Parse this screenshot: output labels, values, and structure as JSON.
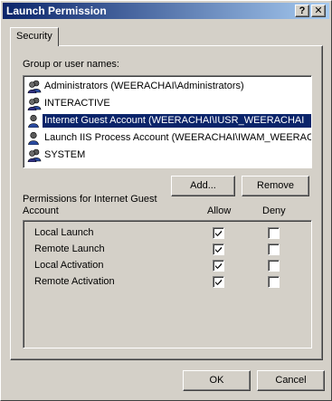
{
  "window": {
    "title": "Launch Permission",
    "help_button": "?",
    "close_button": "✕"
  },
  "tabs": [
    {
      "label": "Security",
      "selected": true
    }
  ],
  "group_label": "Group or user names:",
  "users": [
    {
      "name": "Administrators (WEERACHAI\\Administrators)",
      "icon": "users-group-icon",
      "selected": false
    },
    {
      "name": "INTERACTIVE",
      "icon": "users-group-icon",
      "selected": false
    },
    {
      "name": "Internet Guest Account (WEERACHAI\\IUSR_WEERACHAI",
      "icon": "user-icon",
      "selected": true
    },
    {
      "name": "Launch IIS Process Account (WEERACHAI\\IWAM_WEERACHA",
      "icon": "user-icon",
      "selected": false
    },
    {
      "name": "SYSTEM",
      "icon": "users-group-icon",
      "selected": false
    }
  ],
  "buttons": {
    "add": "Add...",
    "remove": "Remove",
    "ok": "OK",
    "cancel": "Cancel"
  },
  "permissions_label": {
    "line1": "Permissions for Internet Guest",
    "line2": "Account"
  },
  "columns": {
    "allow": "Allow",
    "deny": "Deny"
  },
  "permissions": [
    {
      "name": "Local Launch",
      "allow": true,
      "deny": false
    },
    {
      "name": "Remote Launch",
      "allow": true,
      "deny": false
    },
    {
      "name": "Local Activation",
      "allow": true,
      "deny": false
    },
    {
      "name": "Remote Activation",
      "allow": true,
      "deny": false
    }
  ]
}
